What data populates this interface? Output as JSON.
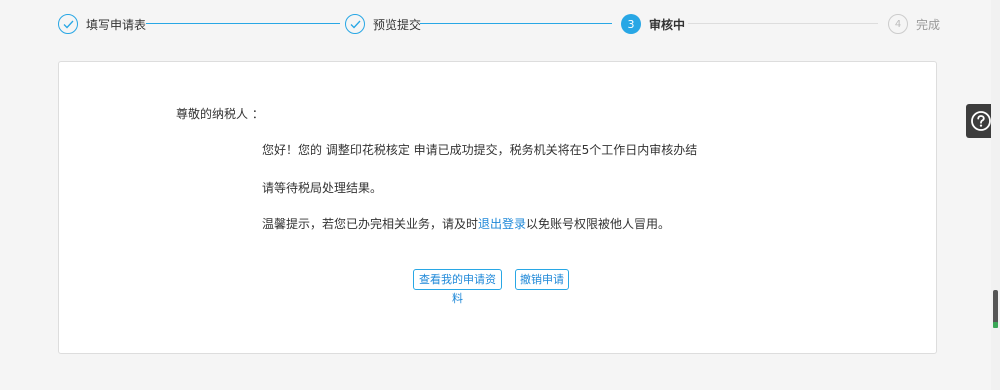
{
  "steps": [
    {
      "label": "填写申请表",
      "state": "done",
      "number": "1"
    },
    {
      "label": "预览提交",
      "state": "done",
      "number": "2"
    },
    {
      "label": "审核中",
      "state": "active",
      "number": "3"
    },
    {
      "label": "完成",
      "state": "todo",
      "number": "4"
    }
  ],
  "message": {
    "greeting": "尊敬的纳税人 ：",
    "line1": "您好！您的 调整印花税核定 申请已成功提交，税务机关将在5个工作日内审核办结",
    "line2": "请等待税局处理结果。",
    "line3_prefix": "温馨提示，若您已办完相关业务，请及时",
    "line3_link": "退出登录",
    "line3_suffix": "以免账号权限被他人冒用。"
  },
  "buttons": {
    "view_label": "查看我的申请资料",
    "cancel_label": "撤销申请"
  },
  "colors": {
    "accent": "#28a7e5",
    "link": "#1e88d8",
    "todo": "#cccccc"
  },
  "icons": {
    "done": "check-icon",
    "help": "question-circle-icon"
  }
}
